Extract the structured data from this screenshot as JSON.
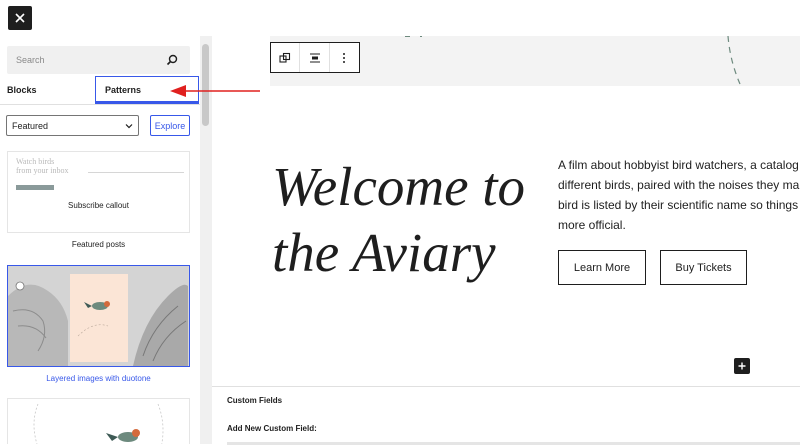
{
  "sidebar": {
    "search_placeholder": "Search",
    "tabs": [
      {
        "label": "Blocks"
      },
      {
        "label": "Patterns"
      }
    ],
    "category_select": "Featured",
    "explore_label": "Explore",
    "patterns": [
      {
        "label": "Subscribe callout",
        "preview_text": "Watch birds\nfrom your inbox"
      },
      {
        "label": "Featured posts"
      },
      {
        "label": "Layered images with duotone"
      }
    ]
  },
  "editor": {
    "hero_title": "Welcome to the Aviary",
    "hero_description": [
      "A film about hobbyist bird watchers, a catalog of",
      "different birds, paired with the noises they make. E",
      "bird is listed by their scientific name so things seem",
      "more official."
    ],
    "buttons": [
      {
        "label": "Learn More"
      },
      {
        "label": "Buy Tickets"
      }
    ]
  },
  "meta_box": {
    "title": "Custom Fields",
    "add_new_label": "Add New Custom Field:"
  },
  "colors": {
    "accent": "#3858e9",
    "annotation_arrow": "#e0201f",
    "duotone_bg": "#fbe5d6"
  },
  "icons": [
    "close-icon",
    "search-icon",
    "chevron-down-icon",
    "duplicate-icon",
    "align-icon",
    "more-options-icon",
    "plus-icon"
  ]
}
